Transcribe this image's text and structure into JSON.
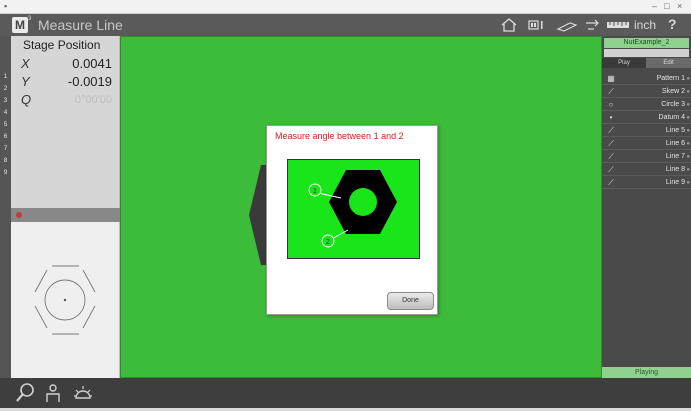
{
  "window": {
    "title": "Measure Line",
    "logo_letter": "M",
    "logo_superscript": "3",
    "units": "inch",
    "help": "?"
  },
  "stage": {
    "title": "Stage Position",
    "x_label": "X",
    "x_value": "0.0041",
    "y_label": "Y",
    "y_value": "-0.0019",
    "q_label": "Q",
    "q_value": "0°00'00"
  },
  "left_strip": [
    "1",
    "2",
    "3",
    "4",
    "5",
    "6",
    "7",
    "8",
    "9"
  ],
  "program": {
    "name": "NutExample_2",
    "tabs": {
      "play": "Play",
      "edit": "Edit"
    },
    "steps": [
      {
        "label": "Pattern 1",
        "icon": "pattern-icon"
      },
      {
        "label": "Skew 2",
        "icon": "line-icon"
      },
      {
        "label": "Circle 3",
        "icon": "circle-icon"
      },
      {
        "label": "Datum 4",
        "icon": "point-icon"
      },
      {
        "label": "Line 5",
        "icon": "line-icon"
      },
      {
        "label": "Line 6",
        "icon": "line-icon"
      },
      {
        "label": "Line 7",
        "icon": "line-icon"
      },
      {
        "label": "Line 8",
        "icon": "line-icon"
      },
      {
        "label": "Line 9",
        "icon": "line-icon"
      }
    ],
    "status": "Playing"
  },
  "dialog": {
    "title": "Measure angle between 1 and 2",
    "marker_1": "1",
    "marker_2": "2",
    "done_label": "Done"
  },
  "colors": {
    "main_view": "#3dbb3a",
    "dialog_image_bg": "#19e619",
    "dialog_title": "#d42020",
    "program_accent": "#8fd28f"
  }
}
